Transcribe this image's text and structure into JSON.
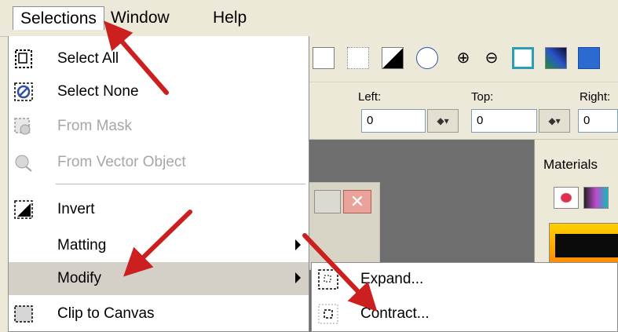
{
  "menubar": {
    "items": [
      {
        "label": "Selections",
        "underline": "S",
        "active": true
      },
      {
        "label": "Window",
        "underline": "W",
        "active": false
      },
      {
        "label": "Help",
        "underline": "H",
        "active": false
      }
    ]
  },
  "menu": {
    "items": [
      {
        "label": "Select All",
        "icon": "select-all-icon"
      },
      {
        "label": "Select None",
        "icon": "select-none-icon"
      },
      {
        "label": "From Mask",
        "icon": "from-mask-icon",
        "disabled": true
      },
      {
        "label": "From Vector Object",
        "icon": "from-vector-icon",
        "disabled": true
      },
      {
        "label": "Invert",
        "icon": "invert-icon"
      },
      {
        "label": "Matting",
        "submenu": true
      },
      {
        "label": "Modify",
        "submenu": true,
        "highlighted": true
      },
      {
        "label": "Clip to Canvas",
        "icon": "clip-canvas-icon"
      }
    ]
  },
  "submenu": {
    "items": [
      {
        "label": "Expand...",
        "icon": "expand-icon"
      },
      {
        "label": "Contract...",
        "icon": "contract-icon"
      }
    ]
  },
  "options": {
    "left_label": "Left:",
    "top_label": "Top:",
    "right_label": "Right:",
    "left_value": "0",
    "top_value": "0",
    "right_value": "0"
  },
  "palette": {
    "title": "Materials"
  },
  "colors": {
    "annotation_arrow": "#cc1f1f",
    "menu_highlight": "#d4d0c8",
    "disabled_text": "#a6a6a6"
  }
}
